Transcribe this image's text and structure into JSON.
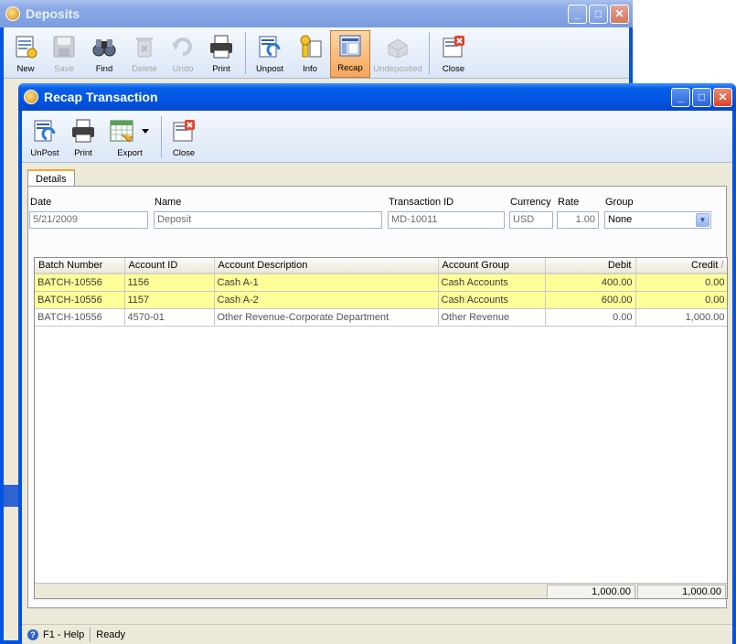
{
  "deposits": {
    "title": "Deposits",
    "toolbar": [
      {
        "label": "New",
        "icon": "new-icon",
        "disabled": false
      },
      {
        "label": "Save",
        "icon": "save-icon",
        "disabled": true
      },
      {
        "label": "Find",
        "icon": "find-icon",
        "disabled": false
      },
      {
        "label": "Delete",
        "icon": "delete-icon",
        "disabled": true
      },
      {
        "label": "Undo",
        "icon": "undo-icon",
        "disabled": true
      },
      {
        "label": "Print",
        "icon": "print-icon",
        "disabled": false
      },
      {
        "label": "Unpost",
        "icon": "unpost-icon",
        "disabled": false
      },
      {
        "label": "Info",
        "icon": "info-icon",
        "disabled": false
      },
      {
        "label": "Recap",
        "icon": "recap-icon",
        "disabled": false,
        "active": true
      },
      {
        "label": "Undeposited",
        "icon": "undeposited-icon",
        "disabled": true
      },
      {
        "label": "Close",
        "icon": "close-icon",
        "disabled": false
      }
    ]
  },
  "recap": {
    "title": "Recap Transaction",
    "toolbar": [
      {
        "label": "UnPost",
        "icon": "unpost-icon"
      },
      {
        "label": "Print",
        "icon": "print-icon"
      },
      {
        "label": "Export",
        "icon": "export-icon"
      },
      {
        "label": "Close",
        "icon": "close-icon"
      }
    ],
    "tab": "Details",
    "fields": {
      "date": {
        "label": "Date",
        "value": "5/21/2009"
      },
      "name": {
        "label": "Name",
        "value": "Deposit"
      },
      "transaction_id": {
        "label": "Transaction ID",
        "value": "MD-10011"
      },
      "currency": {
        "label": "Currency",
        "value": "USD"
      },
      "rate": {
        "label": "Rate",
        "value": "1.00"
      },
      "group": {
        "label": "Group",
        "value": "None"
      }
    },
    "grid": {
      "columns": [
        "Batch Number",
        "Account ID",
        "Account Description",
        "Account Group",
        "Debit",
        "Credit"
      ],
      "rows": [
        {
          "batch": "BATCH-10556",
          "account_id": "1156",
          "description": "Cash A-1",
          "group": "Cash Accounts",
          "debit": "400.00",
          "credit": "0.00",
          "highlight": true
        },
        {
          "batch": "BATCH-10556",
          "account_id": "1157",
          "description": "Cash A-2",
          "group": "Cash Accounts",
          "debit": "600.00",
          "credit": "0.00",
          "highlight": true
        },
        {
          "batch": "BATCH-10556",
          "account_id": "4570-01",
          "description": "Other Revenue-Corporate Department",
          "group": "Other Revenue",
          "debit": "0.00",
          "credit": "1,000.00",
          "highlight": false
        }
      ],
      "total_debit": "1,000.00",
      "total_credit": "1,000.00"
    },
    "status": {
      "help": "F1 - Help",
      "state": "Ready"
    }
  },
  "colors": {
    "titlebar": "#0054e3",
    "highlight_row": "#ffff99",
    "active_tool": "#f4a65a"
  }
}
